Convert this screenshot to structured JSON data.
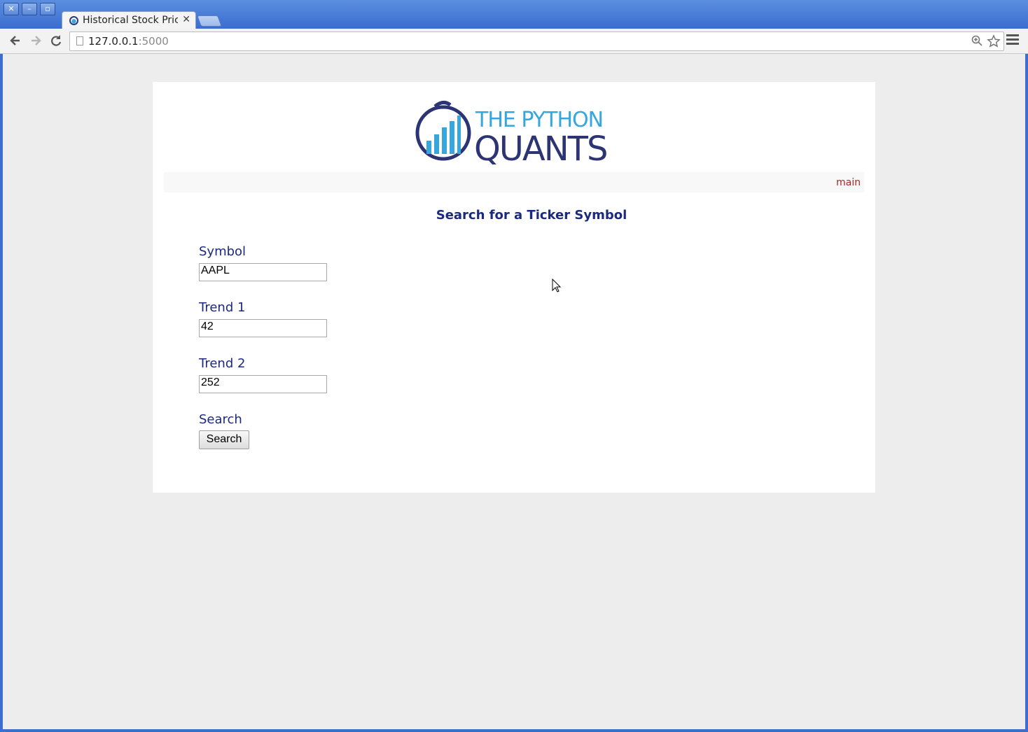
{
  "browser": {
    "tab_title": "Historical Stock Pric",
    "tab_close": "✕",
    "url_host": "127.0.0.1",
    "url_port": ":5000",
    "back_icon": "arrow-left-icon",
    "forward_icon": "arrow-right-icon",
    "reload_icon": "reload-icon",
    "zoom_icon": "zoom-icon",
    "star_icon": "star-icon",
    "menu_icon": "hamburger-menu-icon"
  },
  "logo": {
    "line1": "THE PYTHON",
    "line2": "QUANTS"
  },
  "navbar": {
    "link": "main"
  },
  "form": {
    "heading": "Search for a Ticker Symbol",
    "symbol_label": "Symbol",
    "symbol_value": "AAPL",
    "trend1_label": "Trend 1",
    "trend1_value": "42",
    "trend2_label": "Trend 2",
    "trend2_value": "252",
    "search_label": "Search",
    "search_button": "Search"
  },
  "colors": {
    "accent": "#1b2a7f",
    "link": "#b22222",
    "logo_blue": "#35a6de",
    "logo_navy": "#2c3474"
  }
}
